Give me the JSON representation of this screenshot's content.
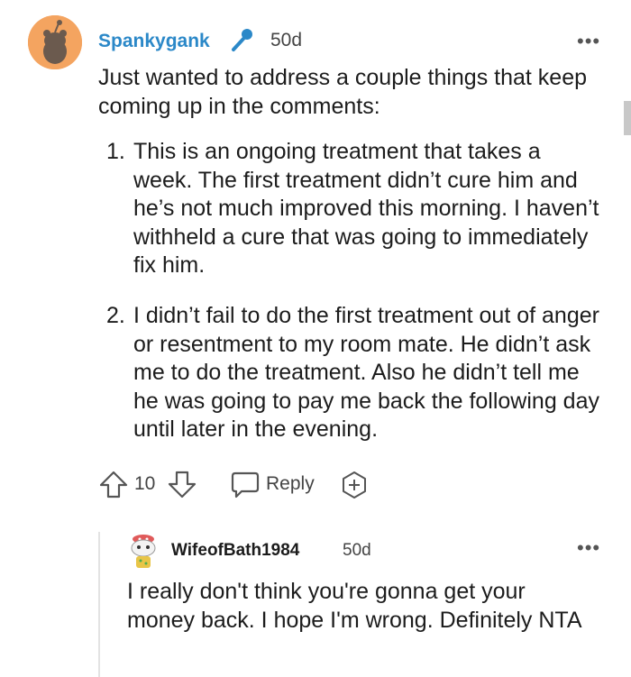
{
  "comment": {
    "author": "Spankygank",
    "age": "50d",
    "more": "•••",
    "intro": "Just wanted to address a couple things that keep coming up in the comments:",
    "list": [
      {
        "num": "1.",
        "text": "This is an ongoing treatment that takes a week. The first treatment didn’t cure him and he’s not much improved this morning. I haven’t withheld a cure that was going to immediately fix him."
      },
      {
        "num": "2.",
        "text": "I didn’t fail to do the first treatment out of anger or resentment to my room mate. He didn’t ask me to do the treatment. Also he didn’t tell me he was going to pay me back the following day until later in the evening."
      }
    ],
    "score": "10",
    "reply_label": "Reply"
  },
  "reply": {
    "author": "WifeofBath1984",
    "age": "50d",
    "more": "•••",
    "text": "I really don't think you're gonna get your money back. I hope I'm wrong. Definitely NTA"
  },
  "colors": {
    "username": "#2b88c8",
    "accent": "#2b88c8",
    "avatar_bg": "#f4a460"
  },
  "icons": [
    "snoo-avatar",
    "microphone-icon",
    "upvote-icon",
    "downvote-icon",
    "reply-bubble-icon",
    "award-plus-icon"
  ]
}
